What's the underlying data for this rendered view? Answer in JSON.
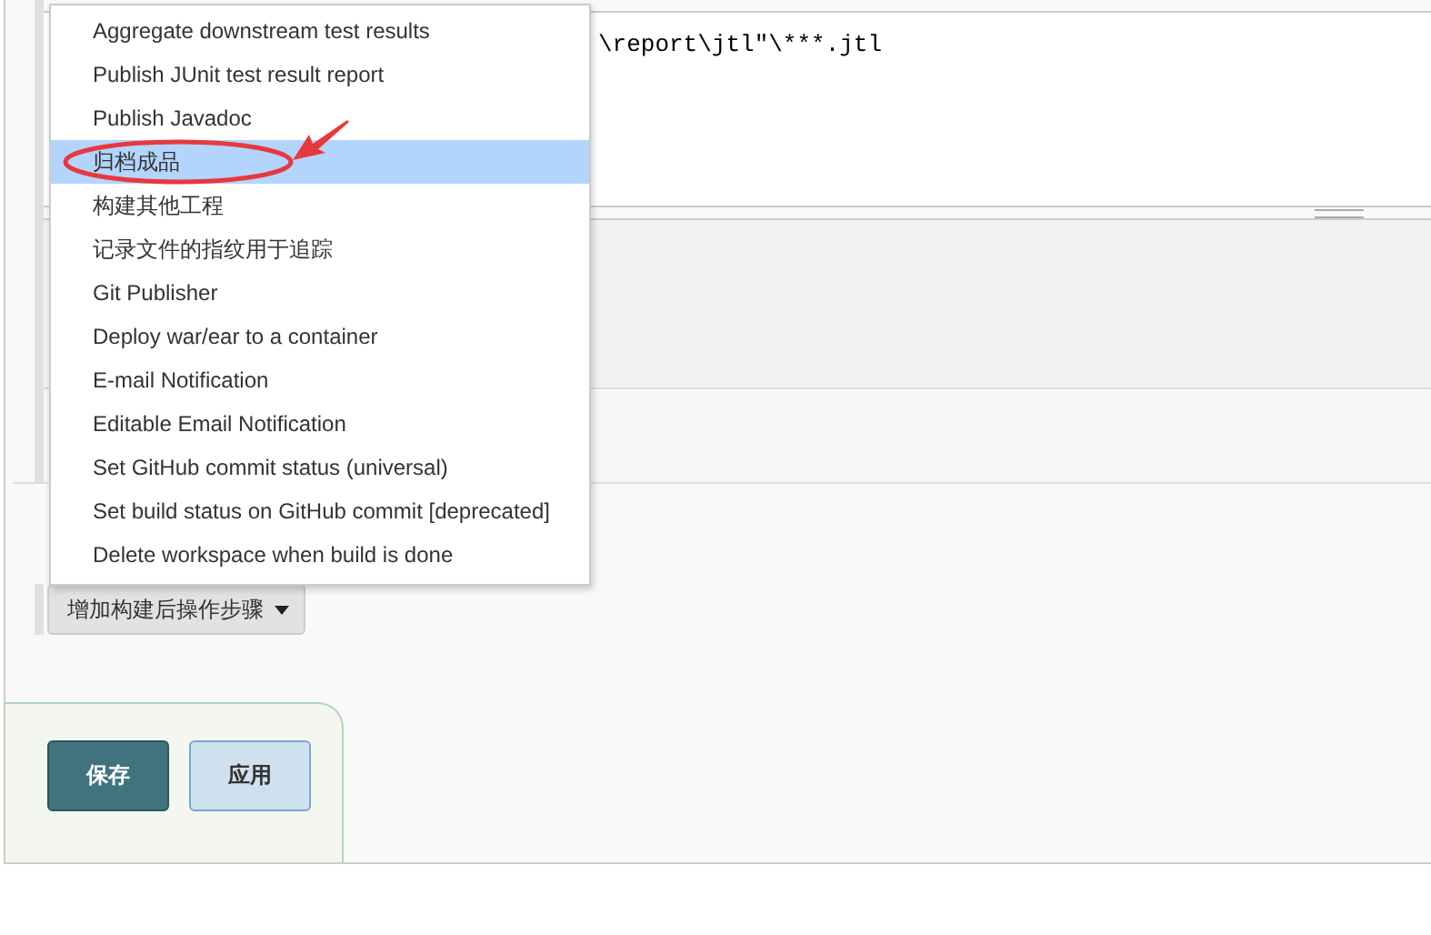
{
  "editor": {
    "value": "\\report\\jtl\"\\***.jtl"
  },
  "menu": {
    "items": [
      {
        "label": "Aggregate downstream test results",
        "selected": false
      },
      {
        "label": "Publish JUnit test result report",
        "selected": false
      },
      {
        "label": "Publish Javadoc",
        "selected": false
      },
      {
        "label": "归档成品",
        "selected": true
      },
      {
        "label": "构建其他工程",
        "selected": false
      },
      {
        "label": "记录文件的指纹用于追踪",
        "selected": false
      },
      {
        "label": "Git Publisher",
        "selected": false
      },
      {
        "label": "Deploy war/ear to a container",
        "selected": false
      },
      {
        "label": "E-mail Notification",
        "selected": false
      },
      {
        "label": "Editable Email Notification",
        "selected": false
      },
      {
        "label": "Set GitHub commit status (universal)",
        "selected": false
      },
      {
        "label": "Set build status on GitHub commit [deprecated]",
        "selected": false
      },
      {
        "label": "Delete workspace when build is done",
        "selected": false
      }
    ]
  },
  "add_step_button": {
    "label": "增加构建后操作步骤"
  },
  "buttons": [
    {
      "label": "保存",
      "kind": "primary"
    },
    {
      "label": "应用",
      "kind": "secondary"
    }
  ]
}
